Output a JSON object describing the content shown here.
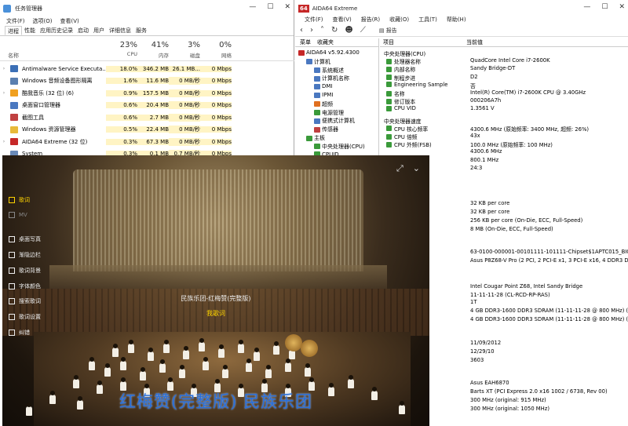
{
  "taskmgr": {
    "title": "任务管理器",
    "menu": [
      "文件(F)",
      "选项(O)",
      "查看(V)"
    ],
    "tabs": [
      "进程",
      "性能",
      "应用历史记录",
      "启动",
      "用户",
      "详细信息",
      "服务"
    ],
    "columns": [
      {
        "pct": "23%",
        "label": "CPU"
      },
      {
        "pct": "41%",
        "label": "内存"
      },
      {
        "pct": "3%",
        "label": "磁盘"
      },
      {
        "pct": "0%",
        "label": "网络"
      }
    ],
    "name_header": "名称",
    "rows": [
      {
        "name": "Antimalware Service Executa...",
        "cpu": "18.0%",
        "mem": "346.2 MB",
        "disk": "26.1 MB...",
        "net": "0 Mbps",
        "exp": "›",
        "color": "#3b6fb6"
      },
      {
        "name": "Windows 音频设备图形隔离",
        "cpu": "1.6%",
        "mem": "11.6 MB",
        "disk": "0 MB/秒",
        "net": "0 Mbps",
        "exp": "",
        "color": "#5a7fb0"
      },
      {
        "name": "酷我音乐 (32 位) (6)",
        "cpu": "0.9%",
        "mem": "157.5 MB",
        "disk": "0 MB/秒",
        "net": "0 Mbps",
        "exp": "›",
        "color": "#f0a020"
      },
      {
        "name": "桌面窗口管理器",
        "cpu": "0.6%",
        "mem": "20.4 MB",
        "disk": "0 MB/秒",
        "net": "0 Mbps",
        "exp": "",
        "color": "#4a78c0"
      },
      {
        "name": "截图工具",
        "cpu": "0.6%",
        "mem": "2.7 MB",
        "disk": "0 MB/秒",
        "net": "0 Mbps",
        "exp": "",
        "color": "#c04040"
      },
      {
        "name": "Windows 资源管理器",
        "cpu": "0.5%",
        "mem": "22.4 MB",
        "disk": "0 MB/秒",
        "net": "0 Mbps",
        "exp": "",
        "color": "#e8b93a"
      },
      {
        "name": "AIDA64 Extreme (32 位)",
        "cpu": "0.3%",
        "mem": "67.3 MB",
        "disk": "0 MB/秒",
        "net": "0 Mbps",
        "exp": "›",
        "color": "#c62828"
      },
      {
        "name": "System",
        "cpu": "0.3%",
        "mem": "0.1 MB",
        "disk": "0.7 MB/秒",
        "net": "0 Mbps",
        "exp": "",
        "color": "#6a8ab8"
      }
    ]
  },
  "aida": {
    "title": "AIDA64 Extreme",
    "logo": "64",
    "menu": [
      "文件(F)",
      "查看(V)",
      "报告(R)",
      "收藏(O)",
      "工具(T)",
      "帮助(H)"
    ],
    "toolbar_report": "报告",
    "tree_tabs": [
      "菜单",
      "收藏夹"
    ],
    "tree": [
      {
        "label": "AIDA64 v5.92.4300",
        "indent": 0,
        "color": "#c62828"
      },
      {
        "label": "计算机",
        "indent": 1,
        "color": "#4a78c0"
      },
      {
        "label": "系统概述",
        "indent": 2,
        "color": "#4a78c0"
      },
      {
        "label": "计算机名称",
        "indent": 2,
        "color": "#4a78c0"
      },
      {
        "label": "DMI",
        "indent": 2,
        "color": "#4a78c0"
      },
      {
        "label": "IPMI",
        "indent": 2,
        "color": "#4a78c0"
      },
      {
        "label": "超频",
        "indent": 2,
        "color": "#e07020"
      },
      {
        "label": "电源管理",
        "indent": 2,
        "color": "#3a9a3a"
      },
      {
        "label": "便携式计算机",
        "indent": 2,
        "color": "#4a78c0"
      },
      {
        "label": "传感器",
        "indent": 2,
        "color": "#c04040"
      },
      {
        "label": "主板",
        "indent": 1,
        "color": "#3a9a3a"
      },
      {
        "label": "中央处理器(CPU)",
        "indent": 2,
        "color": "#3a9a3a"
      },
      {
        "label": "CPUID",
        "indent": 2,
        "color": "#3a9a3a"
      },
      {
        "label": "主板",
        "indent": 2,
        "color": "#3a9a3a"
      }
    ],
    "props_header": [
      "项目",
      "当前值"
    ],
    "sections": [
      {
        "title": "中央处理器(CPU)",
        "rows": [
          [
            "处理器名称",
            "QuadCore Intel Core i7-2600K"
          ],
          [
            "内部名称",
            "Sandy Bridge-DT"
          ],
          [
            "制程步进",
            "D2"
          ],
          [
            "Engineering Sample",
            "否"
          ],
          [
            "名称",
            "Intel(R) Core(TM) i7-2600K CPU @ 3.40GHz"
          ],
          [
            "修订版本",
            "000206A7h"
          ],
          [
            "CPU VID",
            "1.3561 V"
          ]
        ]
      },
      {
        "title": "中央处理器速度",
        "rows": [
          [
            "CPU 核心频率",
            "4300.6 MHz  (原始频率: 3400 MHz, 超频: 26%)"
          ],
          [
            "CPU 倍频",
            "43x"
          ],
          [
            "CPU 外频(FSB)",
            "100.0 MHz  (原始频率: 100 MHz)"
          ],
          [
            "",
            "4300.6 MHz"
          ],
          [
            "",
            "800.1 MHz"
          ],
          [
            "",
            "24:3"
          ]
        ]
      }
    ],
    "lower_values": [
      {
        "name": "",
        "value": "32 KB per core"
      },
      {
        "name": "",
        "value": "32 KB per core"
      },
      {
        "name": "",
        "value": "256 KB per core  (On-Die, ECC, Full-Speed)"
      },
      {
        "name": "",
        "value": "8 MB  (On-Die, ECC, Full-Speed)"
      },
      {
        "name": "",
        "value": "63-0100-000001-00101111-101111-Chipset$1APTC015_BIOS DATE: ..."
      },
      {
        "name": "",
        "value": "Asus P8Z68-V Pro  (2 PCI, 2 PCI-E x1, 3 PCI-E x16, 4 DDR3 DIMM, A..."
      },
      {
        "name": "",
        "value": "Intel Cougar Point Z68, Intel Sandy Bridge"
      },
      {
        "name": "",
        "value": "11-11-11-28  (CL-RCD-RP-RAS)"
      },
      {
        "name": "(CR)",
        "value": "1T"
      },
      {
        "name": "core IMT451U...",
        "value": "4 GB DDR3-1600 DDR3 SDRAM  (11-11-11-28 @ 800 MHz)  (10-10-1..."
      },
      {
        "name": "core IMT451U...",
        "value": "4 GB DDR3-1600 DDR3 SDRAM  (11-11-11-28 @ 800 MHz)  (10-10-1..."
      },
      {
        "name": "期",
        "value": "11/09/2012"
      },
      {
        "name": "期",
        "value": "12/29/10"
      },
      {
        "name": "",
        "value": "3603"
      },
      {
        "name": "",
        "value": "Asus EAH6870"
      },
      {
        "name": "",
        "value": "Barts XT  (PCI Express 2.0 x16 1002 / 6738, Rev 00)"
      },
      {
        "name": "",
        "value": "300 MHz  (original: 915 MHz)"
      },
      {
        "name": "",
        "value": "300 MHz  (original: 1050 MHz)"
      }
    ]
  },
  "player": {
    "menu": [
      {
        "label": "歌词",
        "icon": "lyrics-icon",
        "active": true
      },
      {
        "label": "MV",
        "icon": "mv-icon",
        "active": false
      },
      {
        "label": "桌面写真",
        "icon": "desktop-photo-icon",
        "active": false
      },
      {
        "label": "渐隐边栏",
        "icon": "fade-sidebar-icon",
        "active": false
      },
      {
        "label": "歌词背景",
        "icon": "lyrics-background-icon",
        "active": false
      },
      {
        "label": "字体颜色",
        "icon": "font-color-icon",
        "active": false
      },
      {
        "label": "搜索歌词",
        "icon": "search-lyrics-icon",
        "active": false
      },
      {
        "label": "歌词设置",
        "icon": "lyrics-settings-icon",
        "active": false
      },
      {
        "label": "纠错",
        "icon": "correct-icon",
        "active": false
      }
    ],
    "lyric_current": "民族乐团-红梅赞(完整版)",
    "lyric_next": "我歌词",
    "video_title": "红梅赞(完整版) 民族乐团",
    "controls": [
      "⤢",
      "⌄"
    ]
  }
}
